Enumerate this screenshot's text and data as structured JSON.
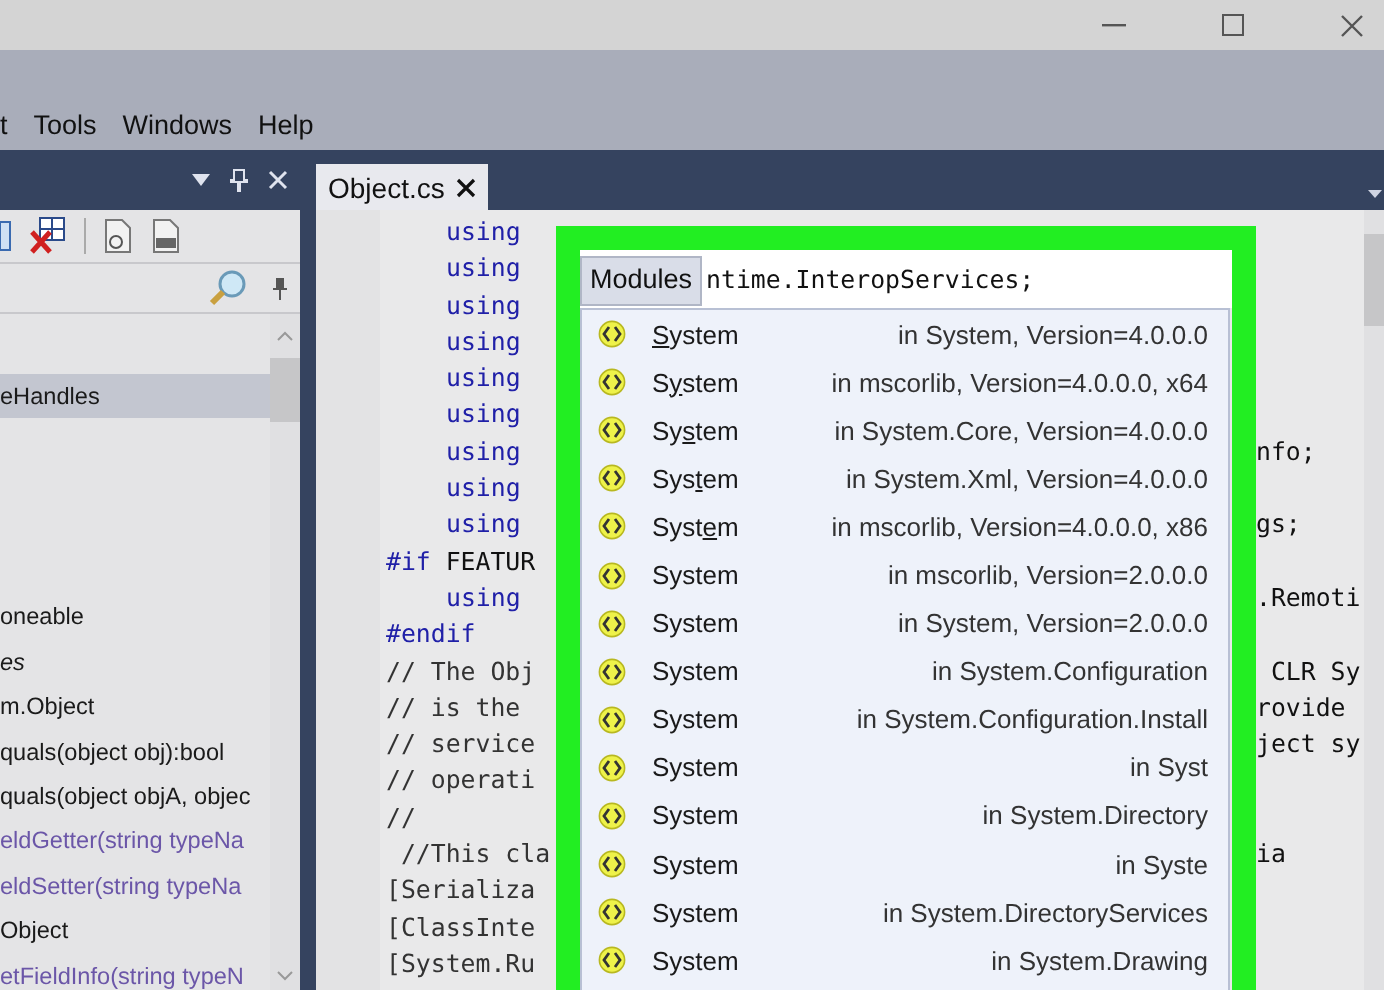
{
  "menu": [
    "t",
    "Tools",
    "Windows",
    "Help"
  ],
  "document_tab": {
    "label": "Object.cs",
    "selected": true
  },
  "tree": {
    "items": [
      {
        "label": "eHandles",
        "kind": "plain",
        "selected": true
      },
      {
        "label": "oneable",
        "kind": "plain",
        "selected": false
      },
      {
        "label": "es",
        "kind": "italic",
        "selected": false
      },
      {
        "label": "m.Object",
        "kind": "plain",
        "selected": false
      },
      {
        "label": "quals(object obj):bool",
        "kind": "plain",
        "selected": false
      },
      {
        "label": "quals(object objA, objec",
        "kind": "plain",
        "selected": false
      },
      {
        "label": "eldGetter(string typeNa",
        "kind": "accent",
        "selected": false
      },
      {
        "label": "eldSetter(string typeNa",
        "kind": "accent",
        "selected": false
      },
      {
        "label": "Object",
        "kind": "plain",
        "selected": false
      },
      {
        "label": "etFieldInfo(string typeN",
        "kind": "accent",
        "selected": false
      }
    ]
  },
  "code": [
    {
      "kind": "statement",
      "keyword": "using"
    },
    {
      "kind": "statement",
      "keyword": "using"
    },
    {
      "kind": "statement",
      "keyword": "using"
    },
    {
      "kind": "statement",
      "keyword": "using"
    },
    {
      "kind": "statement",
      "keyword": "using"
    },
    {
      "kind": "statement",
      "keyword": "using"
    },
    {
      "kind": "statement",
      "keyword": "using",
      "right": "nfo;"
    },
    {
      "kind": "statement",
      "keyword": "using"
    },
    {
      "kind": "statement",
      "keyword": "using",
      "right": "gs;"
    },
    {
      "kind": "directive",
      "keyword": "#if",
      "text": "FEATUR"
    },
    {
      "kind": "statement",
      "keyword": "using",
      "right": ".Remoti"
    },
    {
      "kind": "directive",
      "keyword": "#endif"
    },
    {
      "kind": "comment",
      "text": "// The Obj",
      "right": " CLR Sy"
    },
    {
      "kind": "comment",
      "text": "// is the",
      "right": "rovide"
    },
    {
      "kind": "comment",
      "text": "// service",
      "right": "ject sy"
    },
    {
      "kind": "comment",
      "text": "// operati"
    },
    {
      "kind": "comment",
      "text": "//"
    },
    {
      "kind": "comment",
      "text": " //This cla",
      "right": "ia"
    },
    {
      "kind": "attribute",
      "text": "[Serializa"
    },
    {
      "kind": "attribute",
      "text": "[ClassInte"
    },
    {
      "kind": "attribute",
      "text": "[System.Ru"
    }
  ],
  "popup": {
    "tab": "Modules",
    "code_behind": "ntime.InteropServices;",
    "rows": [
      {
        "pre": "",
        "key": "S",
        "post": "ystem",
        "location": "in System, Version=4.0.0.0"
      },
      {
        "pre": "S",
        "key": "y",
        "post": "stem",
        "location": "in mscorlib, Version=4.0.0.0, x64"
      },
      {
        "pre": "Sy",
        "key": "s",
        "post": "tem",
        "location": "in System.Core, Version=4.0.0.0"
      },
      {
        "pre": "Sys",
        "key": "t",
        "post": "em",
        "location": "in System.Xml, Version=4.0.0.0"
      },
      {
        "pre": "Syst",
        "key": "e",
        "post": "m",
        "location": "in mscorlib, Version=4.0.0.0, x86"
      },
      {
        "name": "System",
        "location": "in mscorlib, Version=2.0.0.0"
      },
      {
        "name": "System",
        "location": "in System, Version=2.0.0.0"
      },
      {
        "name": "System",
        "location": "in System.Configuration"
      },
      {
        "name": "System",
        "location": "in System.Configuration.Install"
      },
      {
        "name": "System",
        "location": "in Syst"
      },
      {
        "name": "System",
        "location": "in System.Directory"
      },
      {
        "name": "System",
        "location": "in Syste"
      },
      {
        "name": "System",
        "location": "in System.DirectoryServices"
      },
      {
        "name": "System",
        "location": "in System.Drawing"
      }
    ]
  }
}
